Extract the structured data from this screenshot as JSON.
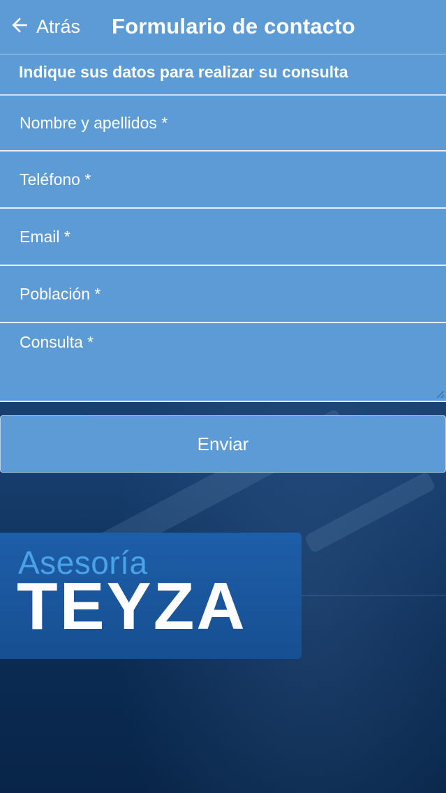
{
  "header": {
    "back_label": "Atrás",
    "title": "Formulario de contacto"
  },
  "form": {
    "instructions": "Indique sus datos para realizar su consulta",
    "fields": {
      "name": {
        "placeholder": "Nombre y apellidos *",
        "value": ""
      },
      "phone": {
        "placeholder": "Teléfono *",
        "value": ""
      },
      "email": {
        "placeholder": "Email *",
        "value": ""
      },
      "city": {
        "placeholder": "Población *",
        "value": ""
      },
      "query": {
        "placeholder": "Consulta *",
        "value": ""
      }
    },
    "submit_label": "Enviar"
  },
  "logo": {
    "line1": "Asesoría",
    "line2": "TEYZA"
  },
  "colors": {
    "header_bg": "#5c9bd6",
    "field_bg": "#5c9bd6",
    "text": "#ffffff",
    "background": "#0b2a52",
    "logo_accent": "#49a3e8"
  },
  "icons": {
    "back": "arrow-left-icon"
  }
}
